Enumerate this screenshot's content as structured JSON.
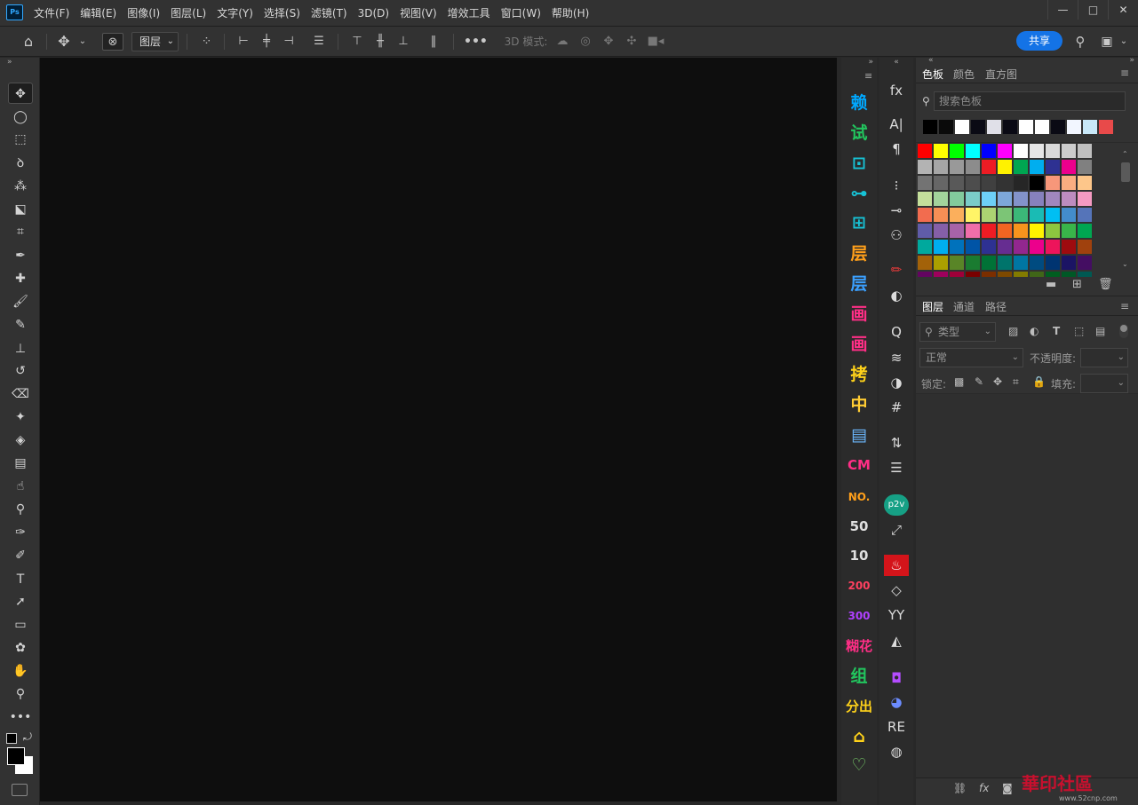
{
  "app": {
    "logo": "Ps"
  },
  "menus": [
    "文件(F)",
    "编辑(E)",
    "图像(I)",
    "图层(L)",
    "文字(Y)",
    "选择(S)",
    "滤镜(T)",
    "3D(D)",
    "视图(V)",
    "增效工具",
    "窗口(W)",
    "帮助(H)"
  ],
  "window_controls": {
    "minimize": "—",
    "maximize": "□",
    "close": "✕"
  },
  "options": {
    "layer_select": "图层",
    "mode_label": "3D 模式:",
    "share": "共享"
  },
  "tools": [
    {
      "name": "move-tool",
      "glyph": "✥"
    },
    {
      "name": "elliptical-marquee-tool",
      "glyph": "◯"
    },
    {
      "name": "rect-marquee-tool",
      "glyph": "⬚"
    },
    {
      "name": "lasso-tool",
      "glyph": "ꝺ"
    },
    {
      "name": "magic-wand-tool",
      "glyph": "⁂"
    },
    {
      "name": "object-select-tool",
      "glyph": "⬕"
    },
    {
      "name": "crop-tool",
      "glyph": "⌗"
    },
    {
      "name": "eyedropper-tool",
      "glyph": "✒"
    },
    {
      "name": "healing-brush-tool",
      "glyph": "✚"
    },
    {
      "name": "brush-tool",
      "glyph": "🖌"
    },
    {
      "name": "pencil-tool",
      "glyph": "✎"
    },
    {
      "name": "clone-stamp-tool",
      "glyph": "⊥"
    },
    {
      "name": "history-brush-tool",
      "glyph": "↺"
    },
    {
      "name": "eraser-tool",
      "glyph": "⌫"
    },
    {
      "name": "background-eraser-tool",
      "glyph": "✦"
    },
    {
      "name": "paint-bucket-tool",
      "glyph": "◈"
    },
    {
      "name": "gradient-tool",
      "glyph": "▤"
    },
    {
      "name": "smudge-tool",
      "glyph": "☝"
    },
    {
      "name": "dodge-tool",
      "glyph": "⚲"
    },
    {
      "name": "pen-tool",
      "glyph": "✑"
    },
    {
      "name": "freeform-pen-tool",
      "glyph": "✐"
    },
    {
      "name": "type-tool",
      "glyph": "T"
    },
    {
      "name": "path-selection-tool",
      "glyph": "➚"
    },
    {
      "name": "rectangle-tool",
      "glyph": "▭"
    },
    {
      "name": "custom-shape-tool",
      "glyph": "✿"
    },
    {
      "name": "hand-tool",
      "glyph": "✋"
    },
    {
      "name": "zoom-tool",
      "glyph": "⚲"
    },
    {
      "name": "more-tools",
      "glyph": "•••"
    }
  ],
  "plugins_col1": [
    {
      "label": "赖",
      "color": "#00a8ff"
    },
    {
      "label": "试",
      "color": "#22c55e"
    },
    {
      "label": "⊡",
      "color": "#17c3d6"
    },
    {
      "label": "⊶",
      "color": "#17c3d6"
    },
    {
      "label": "⊞",
      "color": "#17c3d6"
    },
    {
      "label": "层",
      "color": "#ff9f1a"
    },
    {
      "label": "层",
      "color": "#3ba0ff"
    },
    {
      "label": "画",
      "color": "#ff2e86"
    },
    {
      "label": "画",
      "color": "#ff2e86"
    },
    {
      "label": "拷",
      "color": "#ffd21a"
    },
    {
      "label": "中",
      "color": "#ffcc33"
    },
    {
      "label": "▤",
      "color": "#6cb9ff"
    },
    {
      "label": "CM",
      "color": "#ff2e86"
    },
    {
      "label": "NO.",
      "color": "#ff9f1a"
    },
    {
      "label": "50",
      "color": "#e0e0e0"
    },
    {
      "label": "10",
      "color": "#e0e0e0"
    },
    {
      "label": "200",
      "color": "#ff4060"
    },
    {
      "label": "300",
      "color": "#b040ff"
    },
    {
      "label": "糊花",
      "color": "#ff2e86"
    },
    {
      "label": "组",
      "color": "#22c55e"
    },
    {
      "label": "分出",
      "color": "#ffd21a"
    },
    {
      "label": "⌂",
      "color": "#ffd21a"
    },
    {
      "label": "♡",
      "color": "#7bd36b"
    }
  ],
  "panel_icons_col2": [
    {
      "name": "fx-icon",
      "glyph": "fx"
    },
    {
      "name": "character-icon",
      "glyph": "A|"
    },
    {
      "name": "paragraph-icon",
      "glyph": "¶"
    },
    {
      "name": "brush-settings-icon",
      "glyph": "⁝"
    },
    {
      "name": "brush-presets-icon",
      "glyph": "⊸"
    },
    {
      "name": "clone-source-icon",
      "glyph": "⚇"
    },
    {
      "name": "plugin-red-icon",
      "glyph": "✏"
    },
    {
      "name": "plugin-circle-icon",
      "glyph": "◐"
    },
    {
      "name": "plugin-q-icon",
      "glyph": "Q"
    },
    {
      "name": "layers-stack-icon",
      "glyph": "≋"
    },
    {
      "name": "color-wheel-icon",
      "glyph": "◑"
    },
    {
      "name": "grid-icon",
      "glyph": "#"
    },
    {
      "name": "swap-icon",
      "glyph": "⇅"
    },
    {
      "name": "adjust-icon",
      "glyph": "☰"
    },
    {
      "name": "p2v-icon",
      "glyph": "p2v"
    },
    {
      "name": "expand-icon",
      "glyph": "⤢"
    },
    {
      "name": "fire-icon",
      "glyph": "♨"
    },
    {
      "name": "eraser-plugin-icon",
      "glyph": "◇"
    },
    {
      "name": "yy-icon",
      "glyph": "YY"
    },
    {
      "name": "mountain-icon",
      "glyph": "◭"
    },
    {
      "name": "bottle-icon",
      "glyph": "◘"
    },
    {
      "name": "globe-icon",
      "glyph": "◕"
    },
    {
      "name": "re-icon",
      "glyph": "RE"
    },
    {
      "name": "stripes-icon",
      "glyph": "◍"
    }
  ],
  "swatches_panel": {
    "tabs": [
      "色板",
      "颜色",
      "直方图"
    ],
    "search_placeholder": "搜索色板",
    "recent": [
      "#000000",
      "#0a0a0a",
      "#ffffff",
      "#0a0a14",
      "#e0e0e8",
      "#0a0a14",
      "#ffffff",
      "#ffffff",
      "#0a0a14",
      "#f2f6ff",
      "#c8e8f8",
      "#e84a4a"
    ],
    "grid": [
      [
        "#ff0000",
        "#ffff00",
        "#00ff00",
        "#00ffff",
        "#0000ff",
        "#ff00ff",
        "#ffffff",
        "#e6e6e6",
        "#d9d9d9",
        "#cccccc",
        "#bfbfbf"
      ],
      [
        "#b3b3b3",
        "#a6a6a6",
        "#999999",
        "#8c8c8c",
        "#ed1c24",
        "#fff200",
        "#00a651",
        "#00aeef",
        "#2e3192",
        "#ec008c",
        "#808080"
      ],
      [
        "#737373",
        "#666666",
        "#595959",
        "#4d4d4d",
        "#404040",
        "#333333",
        "#262626",
        "#000000",
        "#f7977a",
        "#f9ad81",
        "#fdc68a"
      ],
      [
        "#c4df9b",
        "#a3d39c",
        "#82ca9c",
        "#7accc8",
        "#6dcff6",
        "#7da7d9",
        "#8393ca",
        "#8781bd",
        "#a187be",
        "#bd8cbf",
        "#f49ac2"
      ],
      [
        "#f26c4f",
        "#f68e55",
        "#fbaf5c",
        "#fff467",
        "#acd372",
        "#7cc576",
        "#3bb878",
        "#1abbb4",
        "#00bff3",
        "#438ccb",
        "#5574b9"
      ],
      [
        "#605ca8",
        "#855fa8",
        "#a763a8",
        "#f06ea9",
        "#ed1c24",
        "#f26522",
        "#f7941d",
        "#fff200",
        "#8dc73f",
        "#39b54a",
        "#00a651"
      ],
      [
        "#00a99d",
        "#00aeef",
        "#0072bc",
        "#0054a6",
        "#2e3192",
        "#662d91",
        "#92278f",
        "#ec008c",
        "#ed145b",
        "#9e0b0f",
        "#a0410d"
      ],
      [
        "#a36209",
        "#aba000",
        "#598527",
        "#1a7b30",
        "#007236",
        "#00746b",
        "#0076a3",
        "#004b80",
        "#003471",
        "#1b1464",
        "#440e62"
      ],
      [
        "#630460",
        "#9e005d",
        "#9e0039",
        "#790000",
        "#7b2e00",
        "#7d4900",
        "#827b00",
        "#406618",
        "#005e20",
        "#005826",
        "#005952"
      ]
    ]
  },
  "layers_panel": {
    "tabs": [
      "图层",
      "通道",
      "路径"
    ],
    "filter": "类型",
    "blend_mode": "正常",
    "opacity_label": "不透明度:",
    "lock_label": "锁定:",
    "fill_label": "填充:"
  },
  "watermark": {
    "text": "華印社區",
    "url": "www.52cnp.com"
  }
}
